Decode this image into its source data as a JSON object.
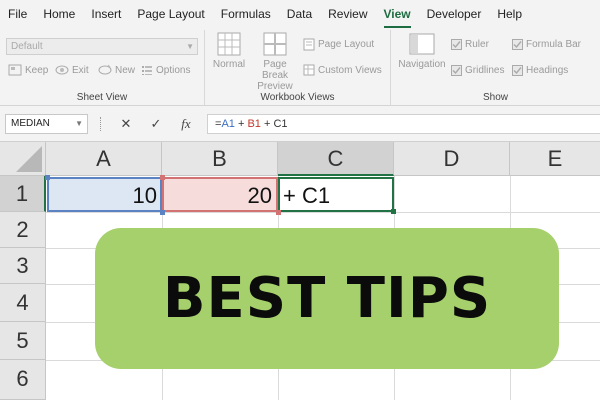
{
  "menu": [
    "File",
    "Home",
    "Insert",
    "Page Layout",
    "Formulas",
    "Data",
    "Review",
    "View",
    "Developer",
    "Help"
  ],
  "active_tab": "View",
  "sheet_view": {
    "dropdown_value": "Default",
    "keep": "Keep",
    "exit": "Exit",
    "new": "New",
    "options": "Options",
    "label": "Sheet View"
  },
  "workbook_views": {
    "normal": "Normal",
    "page_break_1": "Page Break",
    "page_break_2": "Preview",
    "page_layout": "Page Layout",
    "custom_views": "Custom Views",
    "label": "Workbook Views"
  },
  "show": {
    "navigation": "Navigation",
    "ruler": "Ruler",
    "formula_bar": "Formula Bar",
    "gridlines": "Gridlines",
    "headings": "Headings",
    "label": "Show"
  },
  "formula_bar": {
    "name_box": "MEDIAN",
    "cancel": "✕",
    "enter": "✓",
    "fx": "fx",
    "formula_parts": [
      {
        "text": "=",
        "color": "#333333"
      },
      {
        "text": "A1",
        "color": "#3b6fc4"
      },
      {
        "text": " + ",
        "color": "#333333"
      },
      {
        "text": "B1",
        "color": "#c0392b"
      },
      {
        "text": " + C1",
        "color": "#333333"
      }
    ]
  },
  "columns": [
    "A",
    "B",
    "C",
    "D",
    "E"
  ],
  "rows": [
    "1",
    "2",
    "3",
    "4",
    "5",
    "6"
  ],
  "cells": {
    "a1": "10",
    "b1": "20",
    "c1": "+ C1"
  },
  "banner": "BEST TIPS",
  "colors": {
    "accent": "#217346",
    "ref_a1": "#5b82c2",
    "ref_b1": "#d27272",
    "banner": "#a5d06b"
  }
}
